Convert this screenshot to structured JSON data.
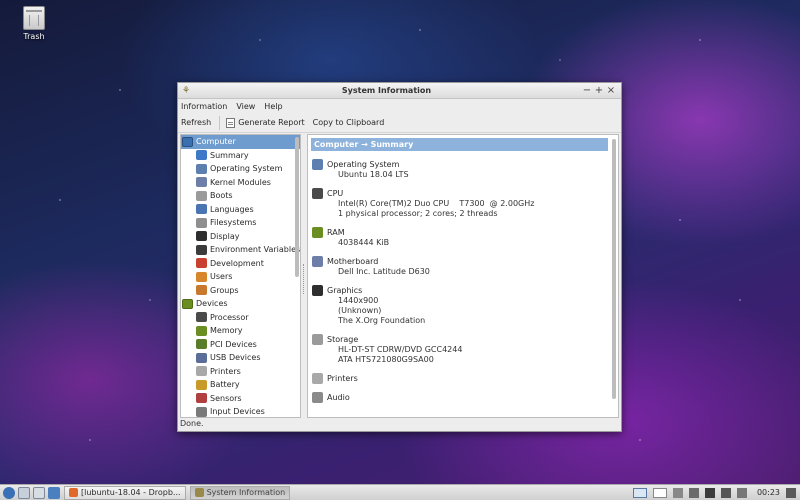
{
  "desktop": {
    "trash_label": "Trash"
  },
  "window": {
    "title": "System Information",
    "controls": {
      "minimize": "−",
      "maximize": "+",
      "close": "×"
    }
  },
  "menu": {
    "information": "Information",
    "view": "View",
    "help": "Help"
  },
  "toolbar": {
    "refresh": "Refresh",
    "generate_report": "Generate Report",
    "copy": "Copy to Clipboard"
  },
  "tree": {
    "computer": {
      "label": "Computer",
      "items": [
        {
          "label": "Summary",
          "icon": "info-icon",
          "color": "#3f78c6"
        },
        {
          "label": "Operating System",
          "icon": "gear-icon",
          "color": "#5c7fb0"
        },
        {
          "label": "Kernel Modules",
          "icon": "diamond-icon",
          "color": "#6d7fa8"
        },
        {
          "label": "Boots",
          "icon": "disc-icon",
          "color": "#9a9a9a"
        },
        {
          "label": "Languages",
          "icon": "languages-icon",
          "color": "#4b74b3"
        },
        {
          "label": "Filesystems",
          "icon": "drive-icon",
          "color": "#8f8f8f"
        },
        {
          "label": "Display",
          "icon": "monitor-icon",
          "color": "#2e2e2e"
        },
        {
          "label": "Environment Variables",
          "icon": "terminal-icon",
          "color": "#3b3b3b"
        },
        {
          "label": "Development",
          "icon": "toolbox-icon",
          "color": "#c8402f"
        },
        {
          "label": "Users",
          "icon": "users-icon",
          "color": "#d8862c"
        },
        {
          "label": "Groups",
          "icon": "groups-icon",
          "color": "#c77a2e"
        }
      ]
    },
    "devices": {
      "label": "Devices",
      "items": [
        {
          "label": "Processor",
          "icon": "cpu-icon",
          "color": "#4a4a4a"
        },
        {
          "label": "Memory",
          "icon": "memory-icon",
          "color": "#6b8e23"
        },
        {
          "label": "PCI Devices",
          "icon": "pci-icon",
          "color": "#5a7d2a"
        },
        {
          "label": "USB Devices",
          "icon": "usb-icon",
          "color": "#5b6e9a"
        },
        {
          "label": "Printers",
          "icon": "printer-icon",
          "color": "#a8a8a8"
        },
        {
          "label": "Battery",
          "icon": "battery-icon",
          "color": "#c79a2a"
        },
        {
          "label": "Sensors",
          "icon": "thermometer-icon",
          "color": "#b04040"
        },
        {
          "label": "Input Devices",
          "icon": "keyboard-icon",
          "color": "#7a7a7a"
        }
      ]
    }
  },
  "details": {
    "header": "Computer → Summary",
    "sections": [
      {
        "title": "Operating System",
        "icon": "gear-icon",
        "color": "#5c7fb0",
        "values": [
          "Ubuntu 18.04 LTS"
        ]
      },
      {
        "title": "CPU",
        "icon": "cpu-icon",
        "color": "#4a4a4a",
        "values": [
          "Intel(R) Core(TM)2 Duo CPU    T7300  @ 2.00GHz",
          "1 physical processor; 2 cores; 2 threads"
        ]
      },
      {
        "title": "RAM",
        "icon": "memory-icon",
        "color": "#6b8e23",
        "values": [
          "4038444 KiB"
        ]
      },
      {
        "title": "Motherboard",
        "icon": "motherboard-icon",
        "color": "#6d7fa8",
        "values": [
          "Dell Inc. Latitude D630"
        ]
      },
      {
        "title": "Graphics",
        "icon": "monitor-icon",
        "color": "#2e2e2e",
        "values": [
          "1440x900",
          "(Unknown)",
          "The X.Org Foundation"
        ]
      },
      {
        "title": "Storage",
        "icon": "drive-icon",
        "color": "#9a9a9a",
        "values": [
          "HL-DT-ST CDRW/DVD GCC4244",
          "ATA HTS721080G9SA00"
        ]
      },
      {
        "title": "Printers",
        "icon": "printer-icon",
        "color": "#a8a8a8",
        "values": []
      },
      {
        "title": "Audio",
        "icon": "audio-icon",
        "color": "#8a8a8a",
        "values": []
      }
    ]
  },
  "status": "Done.",
  "taskbar": {
    "task1": "[lubuntu-18.04 - Dropb...",
    "task2": "System Information",
    "clock": "00:23"
  }
}
